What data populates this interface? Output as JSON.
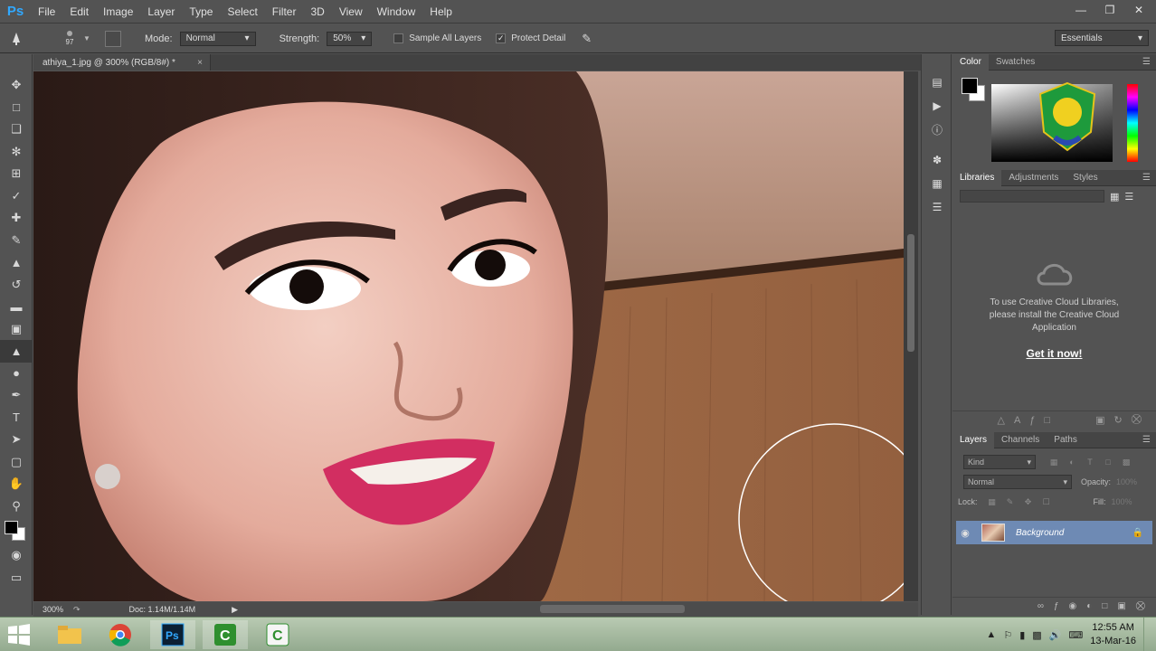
{
  "app": {
    "logo": "Ps",
    "accent": "#31a8ff"
  },
  "menu": [
    "File",
    "Edit",
    "Image",
    "Layer",
    "Type",
    "Select",
    "Filter",
    "3D",
    "View",
    "Window",
    "Help"
  ],
  "options": {
    "brush_size": "97",
    "mode_label": "Mode:",
    "mode_value": "Normal",
    "strength_label": "Strength:",
    "strength_value": "50%",
    "sample_all_layers": "Sample All Layers",
    "protect_detail": "Protect Detail",
    "workspace": "Essentials"
  },
  "document": {
    "tab_title": "athiya_1.jpg @ 300% (RGB/8#) *",
    "zoom": "300%",
    "doc_info": "Doc: 1.14M/1.14M"
  },
  "color_panel": {
    "tabs": [
      "Color",
      "Swatches"
    ]
  },
  "libraries_panel": {
    "tabs": [
      "Libraries",
      "Adjustments",
      "Styles"
    ],
    "message": "To use Creative Cloud Libraries, please install the Creative Cloud Application",
    "link": "Get it now!"
  },
  "layers_panel": {
    "tabs": [
      "Layers",
      "Channels",
      "Paths"
    ],
    "kind": "Kind",
    "blend_mode": "Normal",
    "opacity_label": "Opacity:",
    "opacity_value": "100%",
    "lock_label": "Lock:",
    "fill_label": "Fill:",
    "fill_value": "100%",
    "layers": [
      {
        "name": "Background",
        "visible": true,
        "locked": true
      }
    ]
  },
  "taskbar": {
    "time": "12:55 AM",
    "date": "13-Mar-16",
    "apps": [
      "file-explorer",
      "chrome",
      "photoshop",
      "camtasia",
      "camtasia-recorder"
    ]
  }
}
